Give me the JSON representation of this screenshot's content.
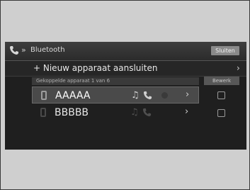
{
  "header": {
    "title": "Bluetooth",
    "button_label": "Sluiten"
  },
  "add_device": {
    "label": "+ Nieuw apparaat aansluiten"
  },
  "list_header": {
    "label": "Gekoppelde apparaat 1 van 6",
    "button_label": "Bewerk"
  },
  "devices": [
    {
      "name": "AAAAA",
      "selected": true
    },
    {
      "name": "BBBBB",
      "selected": false
    }
  ],
  "colors": {
    "screen_bg": "#1f1f1f",
    "header_bg": "#3e3e3e",
    "text": "#ffffff"
  },
  "icons": {
    "header_phone": "phone-icon",
    "music": "music-note-icon",
    "call": "phone-icon",
    "message": "message-icon",
    "arrow": "chevron-right-icon"
  }
}
